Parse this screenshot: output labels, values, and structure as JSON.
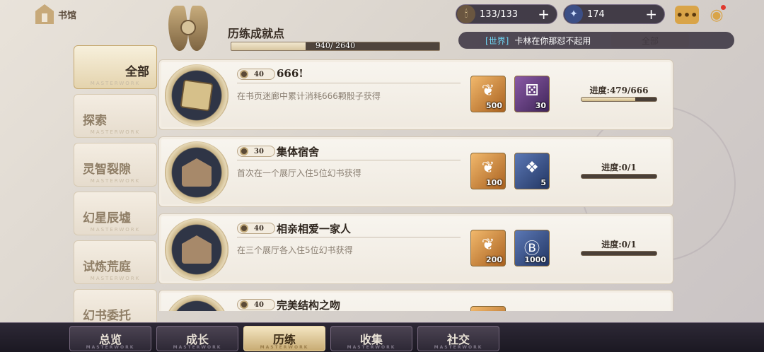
{
  "header": {
    "home_label": "书馆",
    "points_title": "历练成就点",
    "points_text": "940/ 2640",
    "points_progress": 0.356
  },
  "resources": {
    "stamina": "133/133",
    "gems": "174"
  },
  "ticker": {
    "channel": "[世界]",
    "message": "卡林在你那怼不起用"
  },
  "filter": {
    "label": "全部"
  },
  "sidebar": {
    "items": [
      {
        "label": "全部",
        "active": true
      },
      {
        "label": "探索",
        "active": false
      },
      {
        "label": "灵智裂隙",
        "active": false
      },
      {
        "label": "幻星辰墟",
        "active": false
      },
      {
        "label": "试炼荒庭",
        "active": false
      },
      {
        "label": "幻书委托",
        "active": false
      }
    ],
    "tag": "MASTERWORK"
  },
  "achievements": [
    {
      "points": "40",
      "title": "666!",
      "desc": "在书页迷廊中累计消耗666颗骰子获得",
      "badge": "dice-badge",
      "rewards": [
        {
          "qty": "500",
          "icon": "feather-icon",
          "color": "#d98a3a"
        },
        {
          "qty": "30",
          "icon": "dice-icon",
          "color": "#6b3f8a"
        }
      ],
      "progress_label": "进度:479/666",
      "progress": 0.719
    },
    {
      "points": "30",
      "title": "集体宿舍",
      "desc": "首次在一个展厅入住5位幻书获得",
      "badge": "hall-badge",
      "rewards": [
        {
          "qty": "100",
          "icon": "feather-icon",
          "color": "#d98a3a"
        },
        {
          "qty": "5",
          "icon": "gift-icon",
          "color": "#3a5591"
        }
      ],
      "progress_label": "进度:0/1",
      "progress": 0
    },
    {
      "points": "40",
      "title": "相亲相爱一家人",
      "desc": "在三个展厅各入住5位幻书获得",
      "badge": "hall-badge",
      "rewards": [
        {
          "qty": "200",
          "icon": "feather-icon",
          "color": "#d98a3a"
        },
        {
          "qty": "1000",
          "icon": "coin-icon",
          "color": "#3a5591"
        }
      ],
      "progress_label": "进度:0/1",
      "progress": 0
    },
    {
      "points": "40",
      "title": "完美结构之吻",
      "desc": "",
      "badge": "hall-badge",
      "rewards": [],
      "progress_label": "",
      "progress": 0
    }
  ],
  "bottom_nav": {
    "tabs": [
      {
        "label": "总览",
        "active": false
      },
      {
        "label": "成长",
        "active": false
      },
      {
        "label": "历练",
        "active": true
      },
      {
        "label": "收集",
        "active": false
      },
      {
        "label": "社交",
        "active": false
      }
    ],
    "tag": "MASTERWORK"
  }
}
